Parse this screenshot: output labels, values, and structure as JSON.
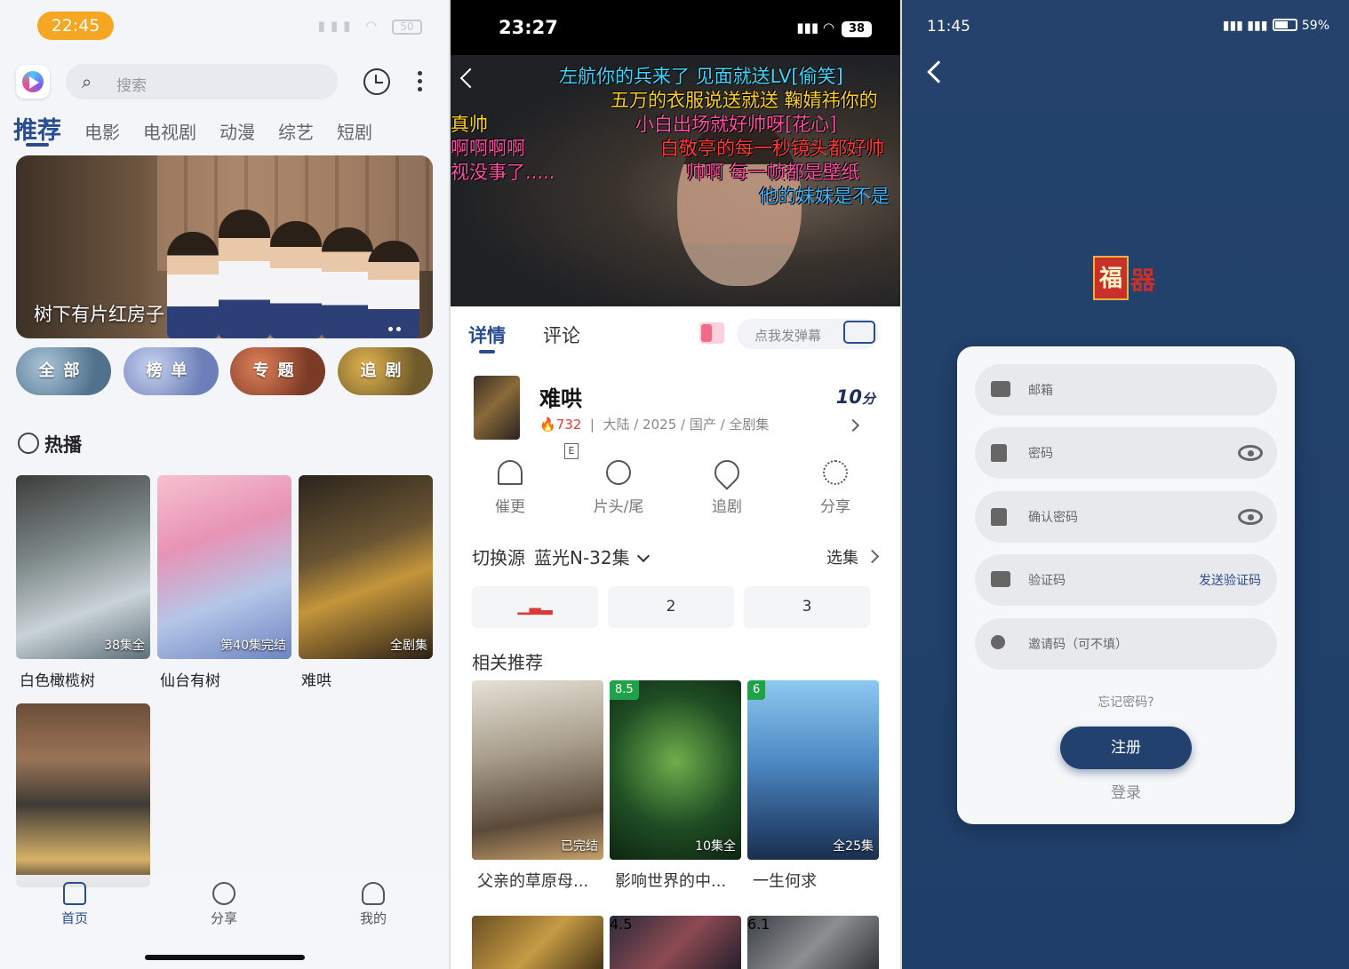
{
  "screen1": {
    "status": {
      "time": "22:45",
      "battery": "50"
    },
    "search": {
      "placeholder": "搜索"
    },
    "tabs": [
      "推荐",
      "电影",
      "电视剧",
      "动漫",
      "综艺",
      "短剧"
    ],
    "banner": {
      "caption": "树下有片红房子"
    },
    "categories": [
      "全部",
      "榜单",
      "专题",
      "追剧"
    ],
    "hot_heading": "热播",
    "posters": [
      {
        "title": "白色橄榄树",
        "badge": "38集全"
      },
      {
        "title": "仙台有树",
        "badge": "第40集完结"
      },
      {
        "title": "难哄",
        "badge": "全剧集"
      },
      {
        "title": "",
        "badge": ""
      }
    ],
    "bottom_nav": [
      "首页",
      "分享",
      "我的"
    ]
  },
  "screen2": {
    "status": {
      "time": "23:27",
      "battery": "38"
    },
    "danmaku": [
      {
        "text": "左航你的兵来了  见面就送LV[偷笑]",
        "color": "#3fd6ff"
      },
      {
        "text": "五万的衣服说送就送  鞠婧祎你的",
        "color": "#ffd21f"
      },
      {
        "text": "小白出场就好帅呀[花心]",
        "color": "#ff4fa3"
      },
      {
        "text": "白敬亭的每一秒镜头都好帅",
        "color": "#ff3a3a"
      },
      {
        "text": "帅啊 每一帧都是壁纸",
        "color": "#ff4fa3"
      },
      {
        "text": "他的妹妹是不是",
        "color": "#3fb6ff"
      },
      {
        "text": "真帅",
        "color": "#ffd21f"
      },
      {
        "text": "啊啊啊啊",
        "color": "#ff4fa3"
      },
      {
        "text": "视没事了.....",
        "color": "#ff4fa3"
      }
    ],
    "tabs": [
      "详情",
      "评论"
    ],
    "danmaku_input": "点我发弹幕",
    "title": "难哄",
    "hot_count": "732",
    "meta": "大陆 / 2025 / 国产 / 全剧集",
    "score": "10",
    "score_unit": "分",
    "e_label": "E",
    "actions": [
      "催更",
      "片头/尾",
      "追剧",
      "分享"
    ],
    "source_label": "切换源",
    "source_value": "蓝光N-32集",
    "episodes_link": "选集",
    "episodes": [
      "",
      "2",
      "3"
    ],
    "related_heading": "相关推荐",
    "related": [
      {
        "title": "父亲的草原母...",
        "badge": "已完结",
        "score": ""
      },
      {
        "title": "影响世界的中...",
        "badge": "10集全",
        "score": "8.5"
      },
      {
        "title": "一生何求",
        "badge": "全25集",
        "score": "6"
      }
    ],
    "related_row2_scores": [
      "",
      "4.5",
      "6.1"
    ]
  },
  "screen3": {
    "status": {
      "time": "11:45",
      "battery": "59%"
    },
    "logo_text": [
      "福",
      "器"
    ],
    "fields": [
      {
        "label": "邮箱"
      },
      {
        "label": "密码"
      },
      {
        "label": "确认密码"
      },
      {
        "label": "验证码",
        "action": "发送验证码"
      },
      {
        "label": "邀请码（可不填）"
      }
    ],
    "forgot": "忘记密码?",
    "register": "注册",
    "login": "登录"
  }
}
